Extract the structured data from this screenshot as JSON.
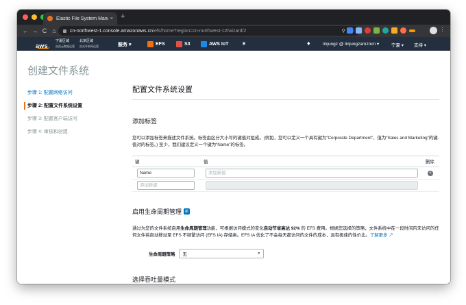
{
  "browser": {
    "tab_title": "Elastic File System Managem…",
    "tab_close": "×",
    "new_tab": "+",
    "url_host": "cn-northwest-1.console.amazonaws.cn",
    "url_path": "/efs/home?region=cn-northwest-1#/wizard/2",
    "nav": {
      "back": "←",
      "forward": "→",
      "reload": "C",
      "home": "⌂"
    },
    "menu": "⋮"
  },
  "aws_nav": {
    "logo": "aws",
    "region1_name": "宁夏区域",
    "region1_sub": "由西云数据运营",
    "region2_name": "北京区域",
    "region2_sub": "由光环新网运营",
    "services": "服务",
    "items": [
      "EFS",
      "S3",
      "AWS IoT"
    ],
    "user": "linjungz @ linjungzamzncn",
    "region_menu": "宁夏",
    "support": "支持"
  },
  "page": {
    "title": "创建文件系统",
    "steps": [
      "步骤 1: 配置网络访问",
      "步骤 2: 配置文件系统设置",
      "步骤 3: 配置客户端访问",
      "步骤 4: 审核和创建"
    ],
    "heading": "配置文件系统设置"
  },
  "tags": {
    "title": "添加标签",
    "description": "您可以添加标签来描述文件系统。标签由区分大小写的键值对组成。(例如，您可以定义一个具有键为“Corporate Department”、值为“Sales and Marketing”的键-值对的标签。) 至少，我们建议定义一个键为“Name”的标签。",
    "col_key": "键",
    "col_value": "值",
    "col_remove": "删除",
    "row1_key": "Name",
    "row1_value_placeholder": "添加新值",
    "row2_key_placeholder": "添加新键",
    "remove_symbol": "×"
  },
  "lifecycle": {
    "title": "启用生命周期管理",
    "badge": "新",
    "desc_a": "通过为您的文件系统启用",
    "desc_b": "生命周期管理",
    "desc_c": "功能，可根据访问模式的变化",
    "desc_d": "自动节省高达 92%",
    "desc_e": " 的 EFS 费用。根据您选择的策略，文件系统中在一段时间内未访问的任何文件将自动移动至 EFS 不频繁访问 (EFS IA) 存储类。EFS IA 优化了不会每天都访问的文件的成本，具有极佳的性价比。",
    "learn_more": "了解更多",
    "policy_label": "生命周期策略",
    "policy_value": "无"
  },
  "throughput": {
    "title": "选择吞吐量模式"
  },
  "colors": {
    "aws_nav_bg": "#232f3e",
    "link": "#0073bb",
    "accent": "#ec7211"
  }
}
